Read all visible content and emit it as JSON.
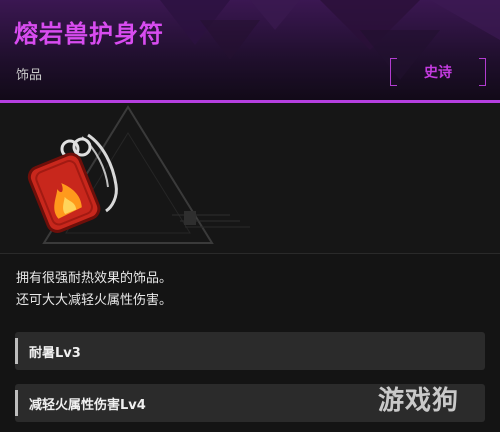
{
  "item": {
    "title": "熔岩兽护身符",
    "category": "饰品",
    "rarity": "史诗"
  },
  "description": {
    "line1": "拥有很强耐热效果的饰品。",
    "line2": "还可大大减轻火属性伤害。"
  },
  "attributes": [
    {
      "label": "耐暑Lv3"
    },
    {
      "label": "减轻火属性伤害Lv4"
    }
  ],
  "watermark": "游戏狗",
  "colors": {
    "accent": "#b53fe0",
    "title": "#d84cf0",
    "rarity": "#c43be0",
    "charm_red": "#c8271c",
    "flame": "#ff9a1c"
  },
  "icons": {
    "item_image": "fire-charm-icon"
  }
}
